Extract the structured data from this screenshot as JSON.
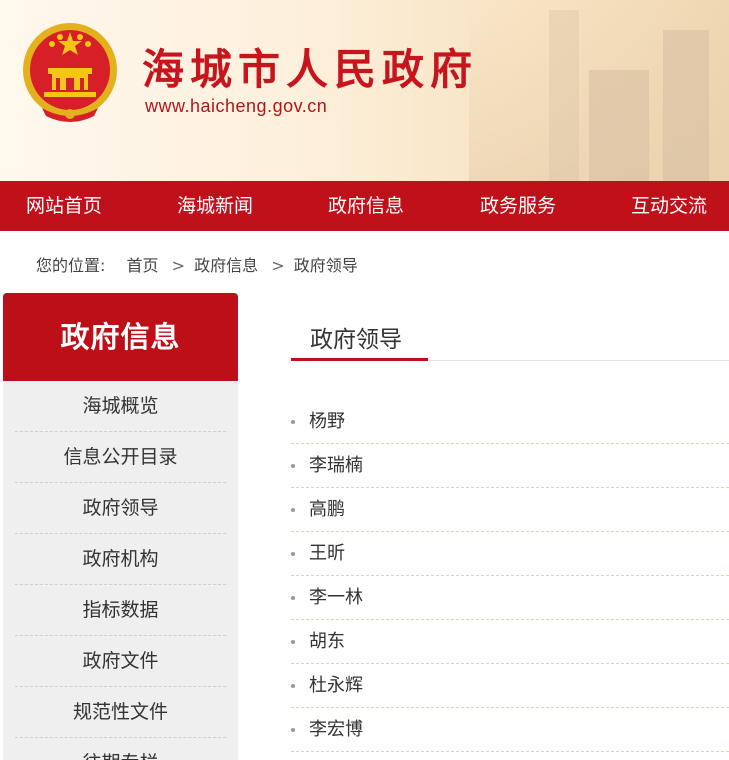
{
  "header": {
    "site_title": "海城市人民政府",
    "site_url": "www.haicheng.gov.cn"
  },
  "nav": {
    "items": [
      {
        "label": "网站首页"
      },
      {
        "label": "海城新闻"
      },
      {
        "label": "政府信息"
      },
      {
        "label": "政务服务"
      },
      {
        "label": "互动交流"
      }
    ]
  },
  "breadcrumb": {
    "prefix": "您的位置:",
    "items": [
      "首页",
      "政府信息",
      "政府领导"
    ],
    "separator": ">"
  },
  "sidebar": {
    "title": "政府信息",
    "items": [
      {
        "label": "海城概览"
      },
      {
        "label": "信息公开目录"
      },
      {
        "label": "政府领导"
      },
      {
        "label": "政府机构"
      },
      {
        "label": "指标数据"
      },
      {
        "label": "政府文件"
      },
      {
        "label": "规范性文件"
      },
      {
        "label": "往期专栏"
      }
    ]
  },
  "main": {
    "title": "政府领导",
    "leaders": [
      {
        "name": "杨野"
      },
      {
        "name": "李瑞楠"
      },
      {
        "name": "高鹏"
      },
      {
        "name": "王昕"
      },
      {
        "name": "李一林"
      },
      {
        "name": "胡东"
      },
      {
        "name": "杜永辉"
      },
      {
        "name": "李宏博"
      }
    ]
  },
  "colors": {
    "brand_red": "#c0101a",
    "sidebar_bg": "#efefef"
  },
  "icons": {
    "emblem": "national-emblem-icon"
  }
}
